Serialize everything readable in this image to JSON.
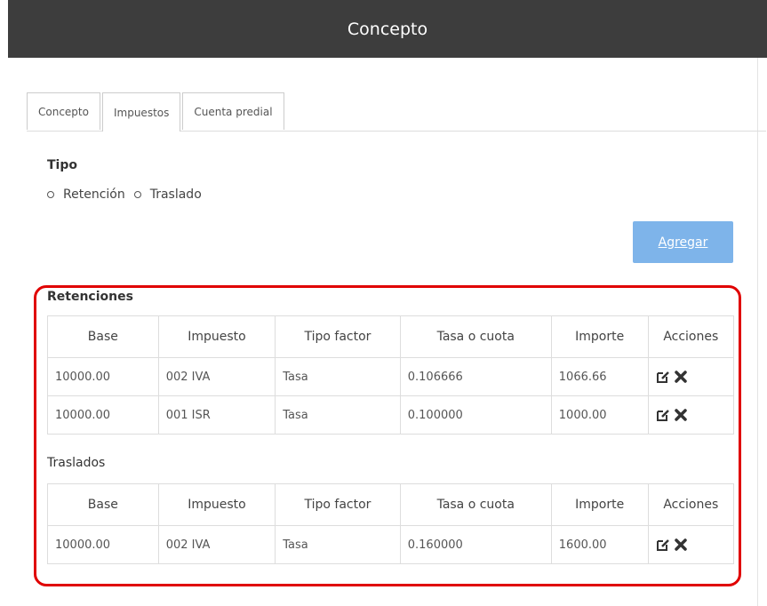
{
  "header": {
    "title": "Concepto"
  },
  "tabs": [
    {
      "label": "Concepto"
    },
    {
      "label": "Impuestos"
    },
    {
      "label": "Cuenta predial"
    }
  ],
  "tipo": {
    "label": "Tipo",
    "options": [
      {
        "label": "Retención"
      },
      {
        "label": "Traslado"
      }
    ]
  },
  "add_button": {
    "label": "Agregar"
  },
  "columns": [
    "Base",
    "Impuesto",
    "Tipo factor",
    "Tasa o cuota",
    "Importe",
    "Acciones"
  ],
  "retenciones": {
    "title": "Retenciones",
    "rows": [
      {
        "base": "10000.00",
        "impuesto": "002 IVA",
        "tipo_factor": "Tasa",
        "tasa": "0.106666",
        "importe": "1066.66"
      },
      {
        "base": "10000.00",
        "impuesto": "001 ISR",
        "tipo_factor": "Tasa",
        "tasa": "0.100000",
        "importe": "1000.00"
      }
    ]
  },
  "traslados": {
    "title": "Traslados",
    "rows": [
      {
        "base": "10000.00",
        "impuesto": "002 IVA",
        "tipo_factor": "Tasa",
        "tasa": "0.160000",
        "importe": "1600.00"
      }
    ]
  },
  "colors": {
    "header_bg": "#3d3d3d",
    "button_bg": "#7eb4ea",
    "highlight": "#e00000"
  },
  "icons": {
    "edit": "edit-icon",
    "delete": "delete-icon"
  }
}
